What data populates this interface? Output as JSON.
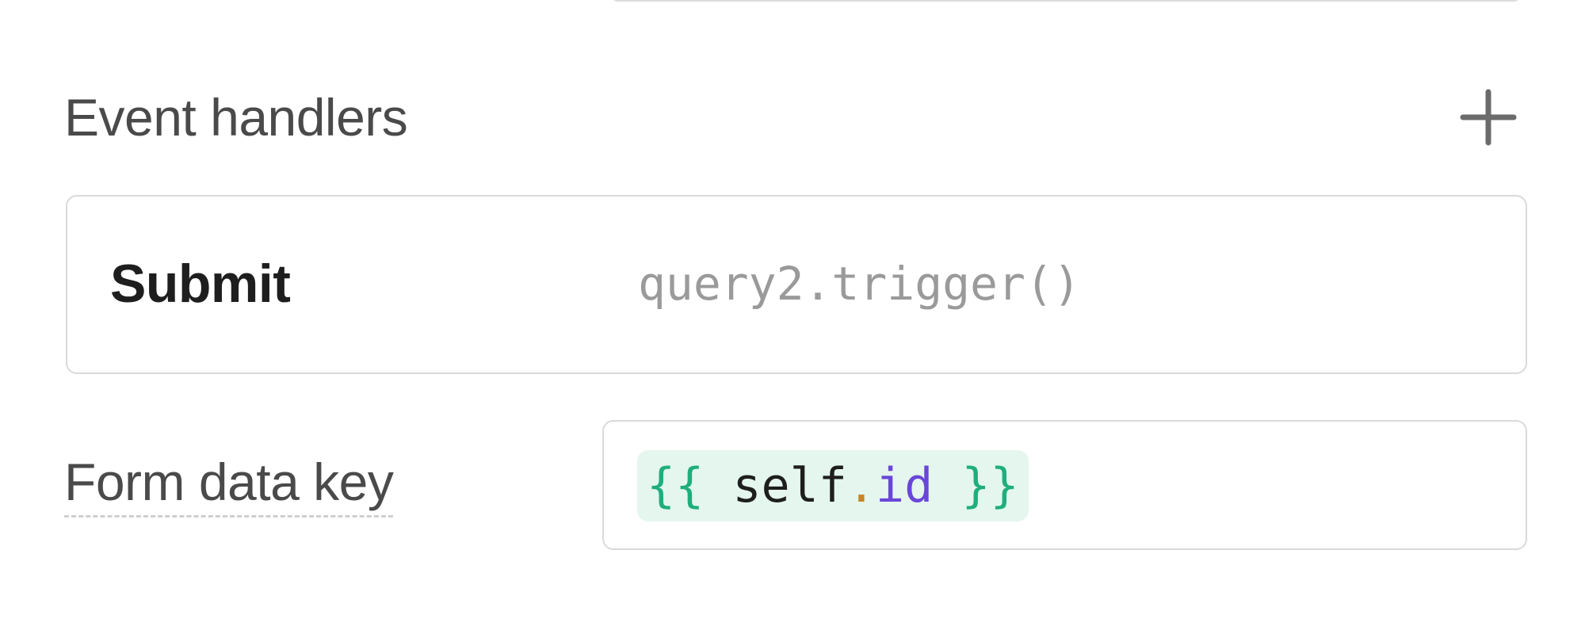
{
  "event_handlers": {
    "title": "Event handlers",
    "add_icon": "plus-icon",
    "handlers": [
      {
        "event": "Submit",
        "action": "query2.trigger()"
      }
    ]
  },
  "form_data_key": {
    "label": "Form data key",
    "value_tokens": {
      "open_brace": "{{",
      "ident": "self",
      "dot": ".",
      "prop": "id",
      "close_brace": "}}"
    }
  },
  "colors": {
    "template_brace": "#1fae7e",
    "template_bg": "#e4f6ee",
    "property": "#6a46d8",
    "dot": "#c8852a"
  }
}
